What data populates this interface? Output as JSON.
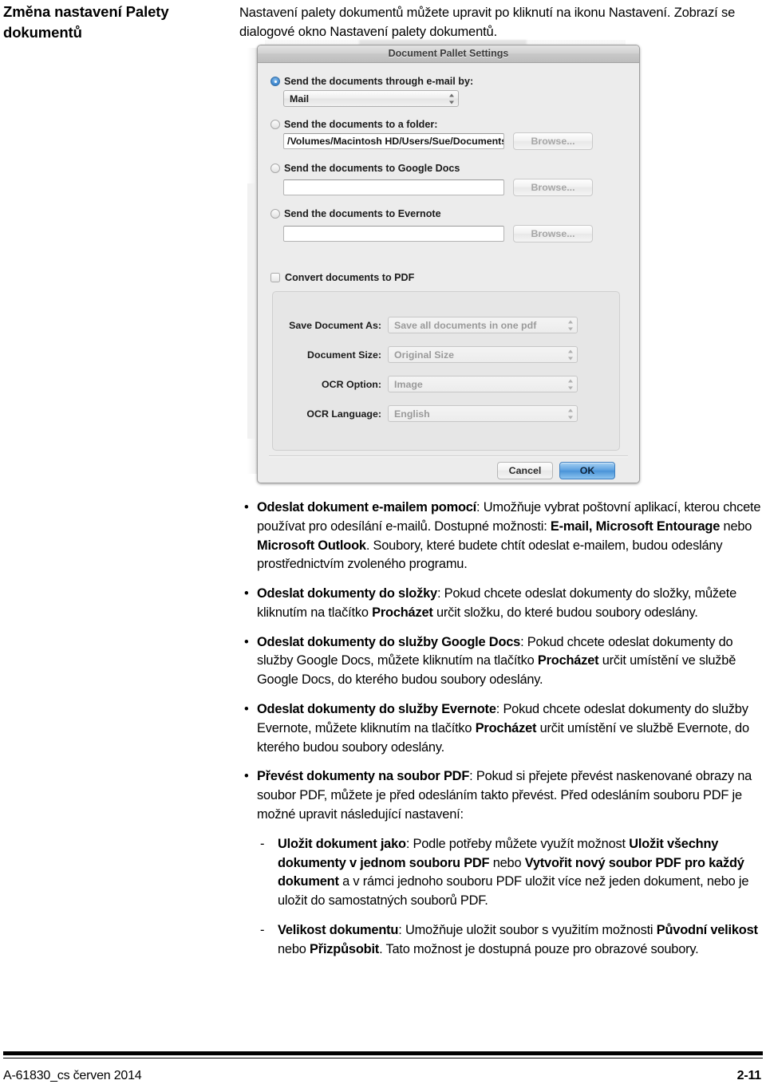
{
  "heading": "Změna nastavení Palety dokumentů",
  "intro": "Nastavení palety dokumentů můžete upravit po kliknutí na ikonu Nastavení. Zobrazí se dialogové okno Nastavení palety dokumentů.",
  "dialog": {
    "title": "Document Pallet Settings",
    "options": {
      "email_label": "Send the documents through e-mail by:",
      "email_select_value": "Mail",
      "folder_label": "Send the documents to a folder:",
      "folder_path_value": "/Volumes/Macintosh HD/Users/Sue/Documents/My",
      "gdocs_label": "Send the documents to Google Docs",
      "gdocs_path_value": "",
      "evernote_label": "Send the documents to Evernote",
      "evernote_path_value": "",
      "browse_label": "Browse..."
    },
    "convert_pdf_label": "Convert documents to PDF",
    "pdf_group": {
      "save_as_label": "Save Document As:",
      "save_as_value": "Save all documents in one pdf",
      "doc_size_label": "Document Size:",
      "doc_size_value": "Original Size",
      "ocr_option_label": "OCR Option:",
      "ocr_option_value": "Image",
      "ocr_language_label": "OCR Language:",
      "ocr_language_value": "English"
    },
    "cancel_label": "Cancel",
    "ok_label": "OK",
    "accent_color": "#5ba1e0"
  },
  "bullets": [
    {
      "marker": "•",
      "html": "<b>Odeslat dokument e-mailem pomocí</b>: Umožňuje vybrat poštovní aplikací, kterou chcete používat pro odesílání e-mailů. Dostupné možnosti: <b>E-mail, Microsoft Entourage</b> nebo <b>Microsoft Outlook</b>. Soubory, které budete chtít odeslat e-mailem, budou odeslány prostřednictvím zvoleného programu."
    },
    {
      "marker": "•",
      "html": "<b>Odeslat dokumenty do složky</b>: Pokud chcete odeslat dokumenty do složky, můžete kliknutím na tlačítko <b>Procházet</b> určit složku, do které budou soubory odeslány."
    },
    {
      "marker": "•",
      "html": "<b>Odeslat dokumenty do služby Google Docs</b>: Pokud chcete odeslat dokumenty do služby Google Docs, můžete kliknutím na tlačítko <b>Procházet</b> určit umístění ve službě Google Docs, do kterého budou soubory odeslány."
    },
    {
      "marker": "•",
      "html": "<b>Odeslat dokumenty do služby Evernote</b>: Pokud chcete odeslat dokumenty do služby Evernote, můžete kliknutím na tlačítko <b>Procházet</b> určit umístění ve službě Evernote, do kterého budou soubory odeslány."
    },
    {
      "marker": "•",
      "html": "<b>Převést dokumenty na soubor PDF</b>: Pokud si přejete převést naskenované obrazy na soubor PDF, můžete je před odesláním takto převést. Před odesláním souboru PDF je možné upravit následující nastavení:"
    }
  ],
  "subbullets": [
    {
      "marker": "-",
      "html": "<b>Uložit dokument jako</b>: Podle potřeby můžete využít možnost <b>Uložit všechny dokumenty v jednom souboru PDF</b> nebo <b>Vytvořit nový soubor PDF pro každý dokument</b> a v rámci jednoho souboru PDF uložit více než jeden dokument, nebo je uložit do samostatných souborů PDF."
    },
    {
      "marker": "-",
      "html": "<b>Velikost dokumentu</b>: Umožňuje uložit soubor s využitím možnosti <b>Původní velikost</b> nebo <b>Přizpůsobit</b>. Tato možnost je dostupná pouze pro obrazové soubory."
    }
  ],
  "footer": {
    "left": "A-61830_cs  červen 2014",
    "right": "2-11"
  }
}
